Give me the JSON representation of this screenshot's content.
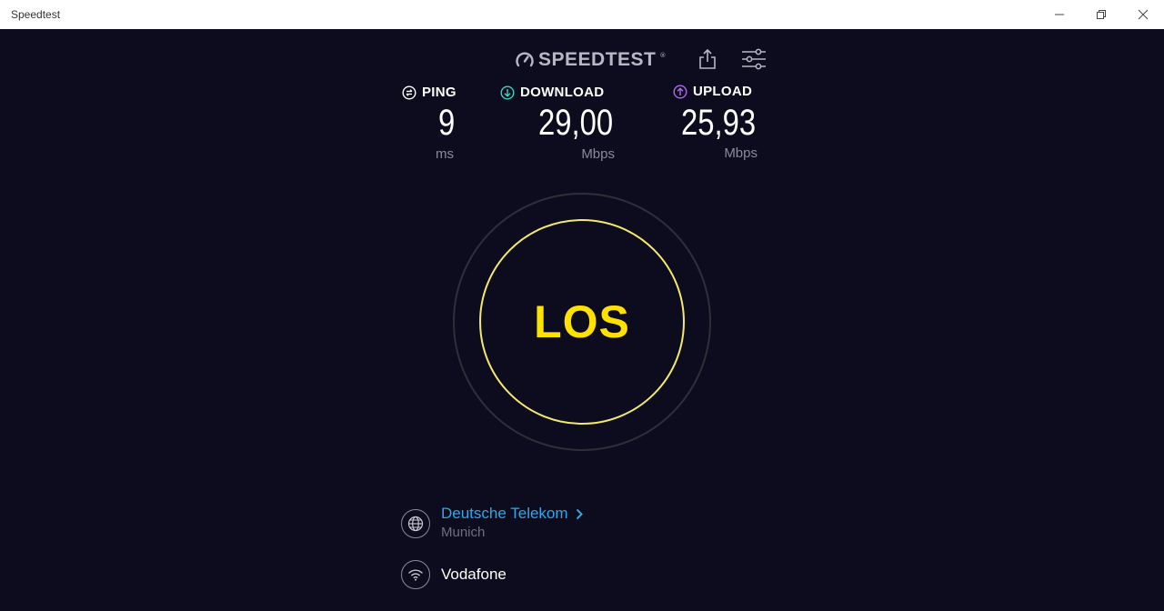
{
  "window": {
    "title": "Speedtest"
  },
  "header": {
    "logo_text": "SPEEDTEST",
    "logo_mark": "®",
    "share_icon": "share-icon",
    "settings_icon": "settings-sliders-icon"
  },
  "metrics": {
    "ping": {
      "label": "PING",
      "value": "9",
      "unit": "ms",
      "icon": "ping-icon",
      "color": "#ffffff"
    },
    "download": {
      "label": "DOWNLOAD",
      "value": "29,00",
      "unit": "Mbps",
      "icon": "download-arrow-icon",
      "color": "#37d6c0"
    },
    "upload": {
      "label": "UPLOAD",
      "value": "25,93",
      "unit": "Mbps",
      "icon": "upload-arrow-icon",
      "color": "#b16cf2"
    }
  },
  "go_button": {
    "label": "LOS",
    "ring_color": "#f5e96a",
    "text_color": "#ffe100"
  },
  "server": {
    "provider": "Deutsche Telekom",
    "location": "Munich",
    "icon": "globe-icon"
  },
  "connection": {
    "name": "Vodafone",
    "icon": "wifi-icon"
  },
  "colors": {
    "background": "#0c0c1e",
    "link": "#2ea8ea"
  }
}
